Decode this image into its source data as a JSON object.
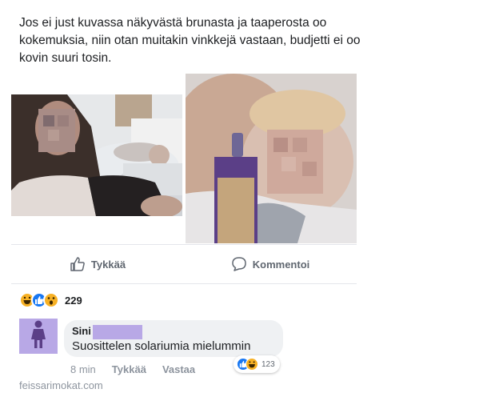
{
  "post": {
    "text": "Jos ei just kuvassa näkyvästä brunasta ja taaperosta oo kokemuksia, niin otan muitakin vinkkejä vastaan, budjetti ei oo kovin suuri tosin."
  },
  "photos": [
    {
      "icon": "photo-woman-with-toddler"
    },
    {
      "icon": "photo-toddler-with-tanning-mousse-bottle"
    }
  ],
  "actions": {
    "like_label": "Tykkää",
    "comment_label": "Kommentoi"
  },
  "reactions": {
    "icons": [
      "haha-icon",
      "like-icon",
      "wow-icon"
    ],
    "count": "229"
  },
  "comment": {
    "author": "Sini",
    "text": "Suosittelen solariumia mielummin",
    "time": "8 min",
    "like_label": "Tykkää",
    "reply_label": "Vastaa",
    "reactions": [
      "like-icon",
      "haha-icon"
    ],
    "reaction_count": "123"
  },
  "watermark": "feissarimokat.com",
  "colors": {
    "accent": "#1877f2",
    "redaction": "#b8a8e6",
    "muted": "#8d949e",
    "bubble": "#eff1f3"
  }
}
